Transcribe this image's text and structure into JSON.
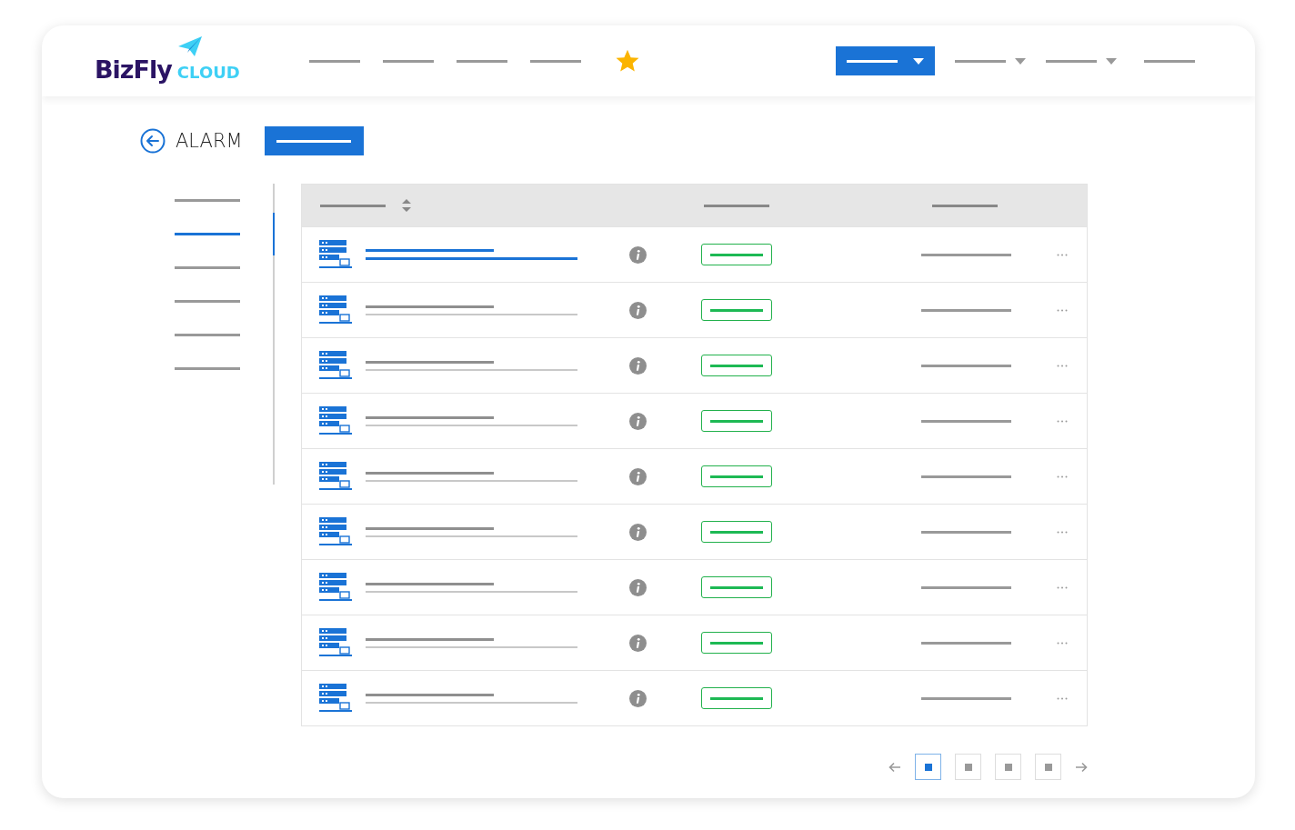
{
  "logo": {
    "brand": "BizFly",
    "suffix": "CLOUD"
  },
  "nav": {
    "links": [
      {
        "selected": false
      },
      {
        "selected": false
      },
      {
        "selected": false
      },
      {
        "selected": false
      }
    ],
    "menus": [
      {
        "kind": "dropdown",
        "selected": true
      },
      {
        "kind": "dropdown",
        "selected": false
      },
      {
        "kind": "dropdown",
        "selected": false
      },
      {
        "kind": "link",
        "selected": false
      }
    ]
  },
  "page": {
    "title": "ALARM"
  },
  "sidebar": {
    "items": [
      {
        "selected": false
      },
      {
        "selected": true
      },
      {
        "selected": false
      },
      {
        "selected": false
      },
      {
        "selected": false
      },
      {
        "selected": false
      }
    ]
  },
  "table": {
    "rows": [
      {
        "selected": true
      },
      {
        "selected": false
      },
      {
        "selected": false
      },
      {
        "selected": false
      },
      {
        "selected": false
      },
      {
        "selected": false
      },
      {
        "selected": false
      },
      {
        "selected": false
      },
      {
        "selected": false
      }
    ]
  },
  "pagination": {
    "pages": [
      {
        "selected": true
      },
      {
        "selected": false
      },
      {
        "selected": false
      },
      {
        "selected": false
      }
    ]
  }
}
